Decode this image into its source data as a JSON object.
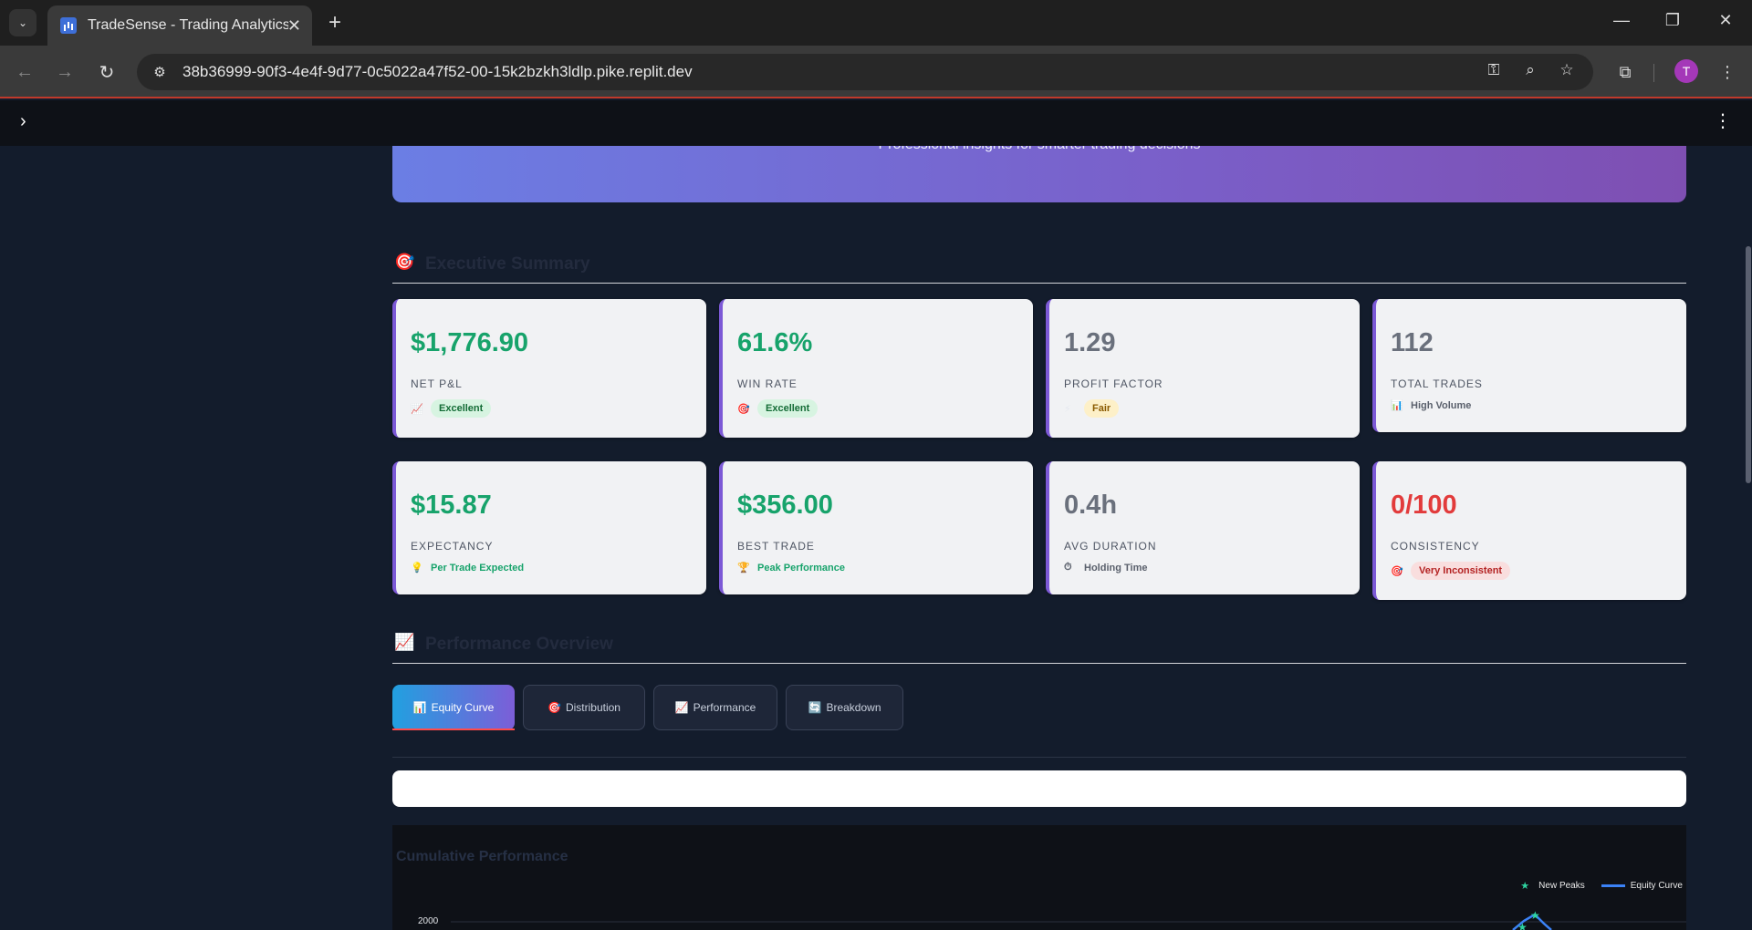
{
  "browser": {
    "tab_title": "TradeSense - Trading Analytics D",
    "url": "38b36999-90f3-4e4f-9d77-0c5022a47f52-00-15k2bzkh3ldlp.pike.replit.dev",
    "profile_initial": "T"
  },
  "hero": {
    "subtitle": "Professional insights for smarter trading decisions"
  },
  "sections": {
    "executive_summary": "Executive Summary",
    "performance_overview": "Performance Overview"
  },
  "metrics": [
    {
      "value": "$1,776.90",
      "label": "NET P&L",
      "icon": "chart-up-icon",
      "badge": "Excellent"
    },
    {
      "value": "61.6%",
      "label": "WIN RATE",
      "icon": "target-icon",
      "badge": "Excellent"
    },
    {
      "value": "1.29",
      "label": "PROFIT FACTOR",
      "icon": "lightning-icon",
      "badge": "Fair"
    },
    {
      "value": "112",
      "label": "TOTAL TRADES",
      "icon": "bar-chart-icon",
      "note": "High Volume"
    },
    {
      "value": "$15.87",
      "label": "EXPECTANCY",
      "icon": "lightbulb-icon",
      "note": "Per Trade Expected"
    },
    {
      "value": "$356.00",
      "label": "BEST TRADE",
      "icon": "trophy-icon",
      "note": "Peak Performance"
    },
    {
      "value": "0.4h",
      "label": "AVG DURATION",
      "icon": "stopwatch-icon",
      "note": "Holding Time"
    },
    {
      "value": "0/100",
      "label": "CONSISTENCY",
      "icon": "target-icon",
      "badge": "Very Inconsistent"
    }
  ],
  "tabs": [
    {
      "label": "Equity Curve",
      "icon": "bar-chart-icon",
      "active": true
    },
    {
      "label": "Distribution",
      "icon": "target-icon",
      "active": false
    },
    {
      "label": "Performance",
      "icon": "chart-up-icon",
      "active": false
    },
    {
      "label": "Breakdown",
      "icon": "refresh-icon",
      "active": false
    }
  ],
  "chart": {
    "title": "Cumulative Performance",
    "legend_peaks": "New Peaks",
    "legend_equity": "Equity Curve",
    "ytick_top": "2000"
  },
  "colors": {
    "accent_purple": "#7c59d6",
    "positive": "#17a36b",
    "negative": "#e23b3b",
    "neutral": "#6a707c"
  }
}
